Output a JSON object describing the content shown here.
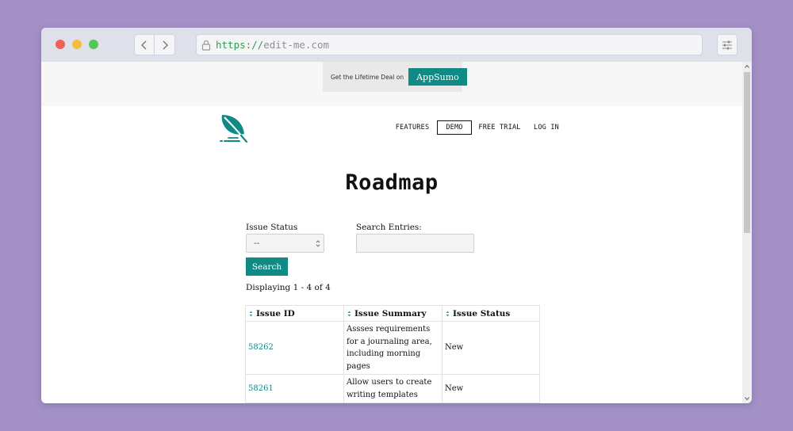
{
  "browser": {
    "url_scheme": "https://",
    "url_host": "edit-me.com"
  },
  "promo": {
    "text": "Get the Lifetime Deal on",
    "button_label": "AppSumo"
  },
  "nav": {
    "items": [
      {
        "label": "FEATURES"
      },
      {
        "label": "DEMO"
      },
      {
        "label": "FREE TRIAL"
      },
      {
        "label": "LOG IN"
      }
    ]
  },
  "page": {
    "title": "Roadmap"
  },
  "filters": {
    "status_label": "Issue Status",
    "status_value": "--",
    "search_label": "Search Entries:",
    "search_value": "",
    "search_button": "Search"
  },
  "results": {
    "displaying": "Displaying 1 - 4 of 4"
  },
  "table": {
    "headers": [
      "Issue ID",
      "Issue Summary",
      "Issue Status"
    ],
    "rows": [
      {
        "id": "58262",
        "summary": "Assses requirements for a journaling area, including morning pages",
        "status": "New"
      },
      {
        "id": "58261",
        "summary": "Allow users to create writing templates",
        "status": "New"
      }
    ]
  },
  "colors": {
    "accent": "#108a84",
    "backdrop": "#a391c6"
  },
  "icons": [
    "lock-icon",
    "chevron-left-icon",
    "chevron-right-icon",
    "sliders-icon",
    "leaf-logo-icon",
    "chevron-down-icon",
    "sort-icon"
  ]
}
